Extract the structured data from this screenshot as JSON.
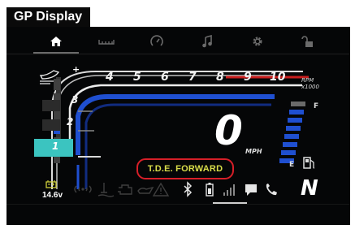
{
  "caption": "GP Display",
  "tabs": [
    {
      "icon": "home-icon",
      "active": true
    },
    {
      "icon": "ruler-icon",
      "active": false
    },
    {
      "icon": "gauge-icon",
      "active": false
    },
    {
      "icon": "music-icon",
      "active": false
    },
    {
      "icon": "gear-icon",
      "active": false
    },
    {
      "icon": "padlock-icon",
      "active": false
    }
  ],
  "tachometer": {
    "scale_numbers": [
      "4",
      "5",
      "6",
      "7",
      "8",
      "9",
      "10"
    ],
    "unit_line1": "RPM",
    "unit_line2": "x1000"
  },
  "gears": [
    "1",
    "2",
    "3"
  ],
  "current_gear": "1",
  "speed": {
    "value": "0",
    "unit": "MPH"
  },
  "mode_label": "T.D.E. FORWARD",
  "fuel": {
    "full_label": "F",
    "empty_label": "E",
    "level": 0.75
  },
  "trim": {
    "plus_label": "+",
    "minus_label": "−"
  },
  "battery_voltage": "14.6v",
  "status_icons": [
    "battery-icon",
    "signal-icon",
    "oil-temperature-icon",
    "engine-check-icon",
    "oil-pressure-icon",
    "warning-icon",
    "bluetooth-icon",
    "phone-battery-icon",
    "phone-signal-icon",
    "message-icon",
    "phone-call-icon"
  ],
  "neutral_indicator": "N",
  "colors": {
    "accent_blue": "#1f4fd0",
    "gear_teal": "#3bc4c0",
    "mode_text": "#d9de4a",
    "mode_border": "#d71f28",
    "redline": "#c81e1e"
  }
}
